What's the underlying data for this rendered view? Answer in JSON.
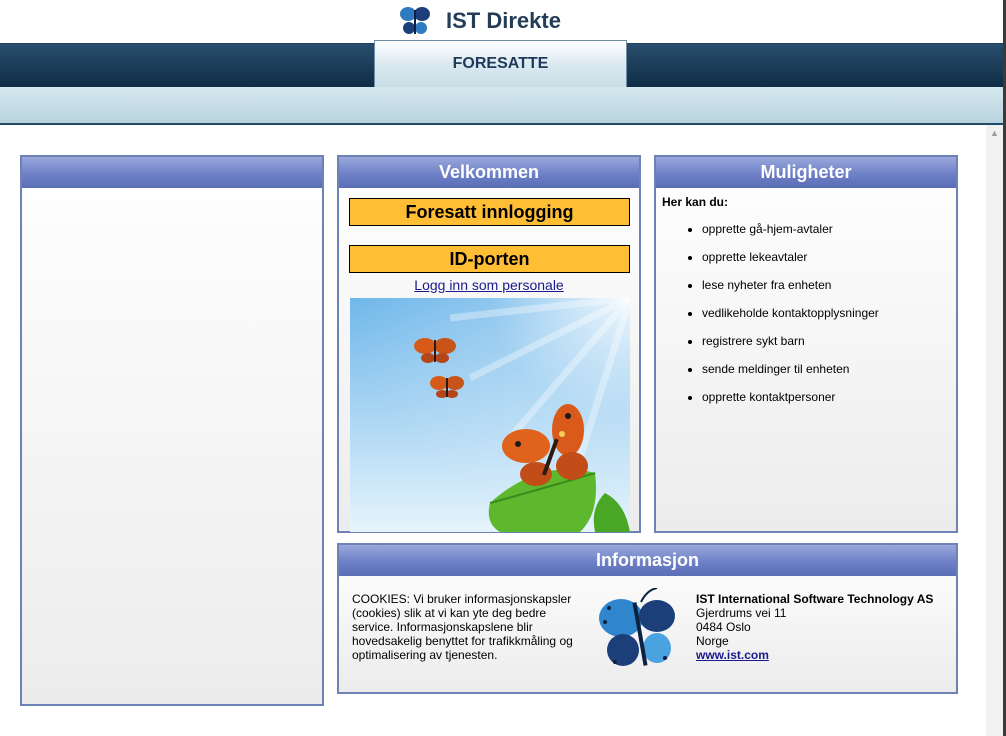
{
  "header": {
    "app_title": "IST Direkte",
    "active_tab": "FORESATTE"
  },
  "left_panel": {
    "title": ""
  },
  "welcome": {
    "title": "Velkommen",
    "login_parent_label": "Foresatt innlogging",
    "login_idporten_label": "ID-porten",
    "staff_login_link": "Logg inn som personale"
  },
  "options": {
    "title": "Muligheter",
    "intro": "Her kan du:",
    "items": [
      "opprette gå-hjem-avtaler",
      "opprette lekeavtaler",
      "lese nyheter fra enheten",
      "vedlikeholde kontaktopplysninger",
      "registrere sykt barn",
      "sende meldinger til enheten",
      "opprette kontaktpersoner"
    ]
  },
  "info": {
    "title": "Informasjon",
    "cookies_lines": [
      "COOKIES: Vi bruker informasjonskapsler",
      "(cookies) slik at vi kan yte deg bedre",
      "service. Informasjonskapslene blir",
      "hovedsakelig benyttet for trafikkmåling og",
      "optimalisering av tjenesten."
    ],
    "company_name": "IST International Software Technology AS",
    "address_street": "Gjerdrums vei 11",
    "address_city": "0484 Oslo",
    "address_country": "Norge",
    "website": "www.ist.com"
  },
  "colors": {
    "accent_button": "#ffbe33",
    "panel_header": "#6e80c6",
    "nav_dark": "#0f2c45"
  }
}
